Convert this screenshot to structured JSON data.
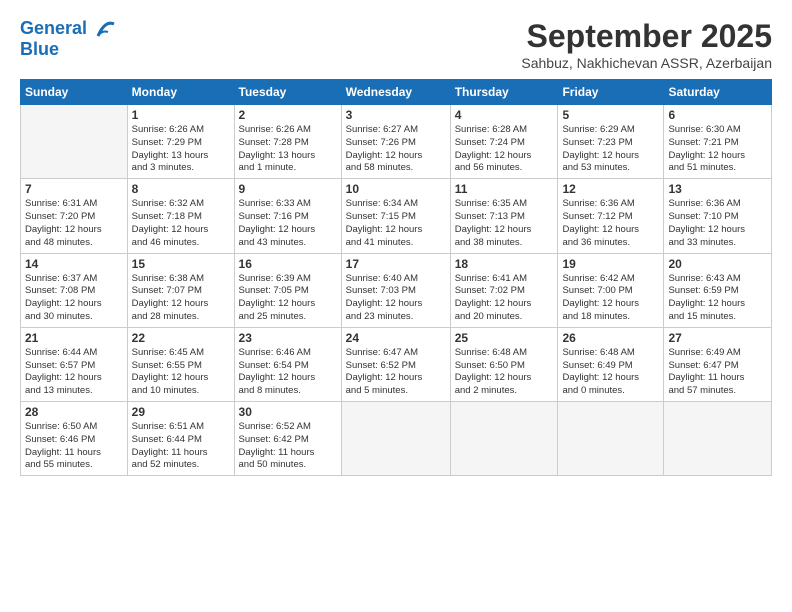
{
  "logo": {
    "line1": "General",
    "line2": "Blue"
  },
  "title": "September 2025",
  "location": "Sahbuz, Nakhichevan ASSR, Azerbaijan",
  "days_header": [
    "Sunday",
    "Monday",
    "Tuesday",
    "Wednesday",
    "Thursday",
    "Friday",
    "Saturday"
  ],
  "weeks": [
    [
      {
        "num": "",
        "info": ""
      },
      {
        "num": "1",
        "info": "Sunrise: 6:26 AM\nSunset: 7:29 PM\nDaylight: 13 hours\nand 3 minutes."
      },
      {
        "num": "2",
        "info": "Sunrise: 6:26 AM\nSunset: 7:28 PM\nDaylight: 13 hours\nand 1 minute."
      },
      {
        "num": "3",
        "info": "Sunrise: 6:27 AM\nSunset: 7:26 PM\nDaylight: 12 hours\nand 58 minutes."
      },
      {
        "num": "4",
        "info": "Sunrise: 6:28 AM\nSunset: 7:24 PM\nDaylight: 12 hours\nand 56 minutes."
      },
      {
        "num": "5",
        "info": "Sunrise: 6:29 AM\nSunset: 7:23 PM\nDaylight: 12 hours\nand 53 minutes."
      },
      {
        "num": "6",
        "info": "Sunrise: 6:30 AM\nSunset: 7:21 PM\nDaylight: 12 hours\nand 51 minutes."
      }
    ],
    [
      {
        "num": "7",
        "info": "Sunrise: 6:31 AM\nSunset: 7:20 PM\nDaylight: 12 hours\nand 48 minutes."
      },
      {
        "num": "8",
        "info": "Sunrise: 6:32 AM\nSunset: 7:18 PM\nDaylight: 12 hours\nand 46 minutes."
      },
      {
        "num": "9",
        "info": "Sunrise: 6:33 AM\nSunset: 7:16 PM\nDaylight: 12 hours\nand 43 minutes."
      },
      {
        "num": "10",
        "info": "Sunrise: 6:34 AM\nSunset: 7:15 PM\nDaylight: 12 hours\nand 41 minutes."
      },
      {
        "num": "11",
        "info": "Sunrise: 6:35 AM\nSunset: 7:13 PM\nDaylight: 12 hours\nand 38 minutes."
      },
      {
        "num": "12",
        "info": "Sunrise: 6:36 AM\nSunset: 7:12 PM\nDaylight: 12 hours\nand 36 minutes."
      },
      {
        "num": "13",
        "info": "Sunrise: 6:36 AM\nSunset: 7:10 PM\nDaylight: 12 hours\nand 33 minutes."
      }
    ],
    [
      {
        "num": "14",
        "info": "Sunrise: 6:37 AM\nSunset: 7:08 PM\nDaylight: 12 hours\nand 30 minutes."
      },
      {
        "num": "15",
        "info": "Sunrise: 6:38 AM\nSunset: 7:07 PM\nDaylight: 12 hours\nand 28 minutes."
      },
      {
        "num": "16",
        "info": "Sunrise: 6:39 AM\nSunset: 7:05 PM\nDaylight: 12 hours\nand 25 minutes."
      },
      {
        "num": "17",
        "info": "Sunrise: 6:40 AM\nSunset: 7:03 PM\nDaylight: 12 hours\nand 23 minutes."
      },
      {
        "num": "18",
        "info": "Sunrise: 6:41 AM\nSunset: 7:02 PM\nDaylight: 12 hours\nand 20 minutes."
      },
      {
        "num": "19",
        "info": "Sunrise: 6:42 AM\nSunset: 7:00 PM\nDaylight: 12 hours\nand 18 minutes."
      },
      {
        "num": "20",
        "info": "Sunrise: 6:43 AM\nSunset: 6:59 PM\nDaylight: 12 hours\nand 15 minutes."
      }
    ],
    [
      {
        "num": "21",
        "info": "Sunrise: 6:44 AM\nSunset: 6:57 PM\nDaylight: 12 hours\nand 13 minutes."
      },
      {
        "num": "22",
        "info": "Sunrise: 6:45 AM\nSunset: 6:55 PM\nDaylight: 12 hours\nand 10 minutes."
      },
      {
        "num": "23",
        "info": "Sunrise: 6:46 AM\nSunset: 6:54 PM\nDaylight: 12 hours\nand 8 minutes."
      },
      {
        "num": "24",
        "info": "Sunrise: 6:47 AM\nSunset: 6:52 PM\nDaylight: 12 hours\nand 5 minutes."
      },
      {
        "num": "25",
        "info": "Sunrise: 6:48 AM\nSunset: 6:50 PM\nDaylight: 12 hours\nand 2 minutes."
      },
      {
        "num": "26",
        "info": "Sunrise: 6:48 AM\nSunset: 6:49 PM\nDaylight: 12 hours\nand 0 minutes."
      },
      {
        "num": "27",
        "info": "Sunrise: 6:49 AM\nSunset: 6:47 PM\nDaylight: 11 hours\nand 57 minutes."
      }
    ],
    [
      {
        "num": "28",
        "info": "Sunrise: 6:50 AM\nSunset: 6:46 PM\nDaylight: 11 hours\nand 55 minutes."
      },
      {
        "num": "29",
        "info": "Sunrise: 6:51 AM\nSunset: 6:44 PM\nDaylight: 11 hours\nand 52 minutes."
      },
      {
        "num": "30",
        "info": "Sunrise: 6:52 AM\nSunset: 6:42 PM\nDaylight: 11 hours\nand 50 minutes."
      },
      {
        "num": "",
        "info": ""
      },
      {
        "num": "",
        "info": ""
      },
      {
        "num": "",
        "info": ""
      },
      {
        "num": "",
        "info": ""
      }
    ]
  ]
}
